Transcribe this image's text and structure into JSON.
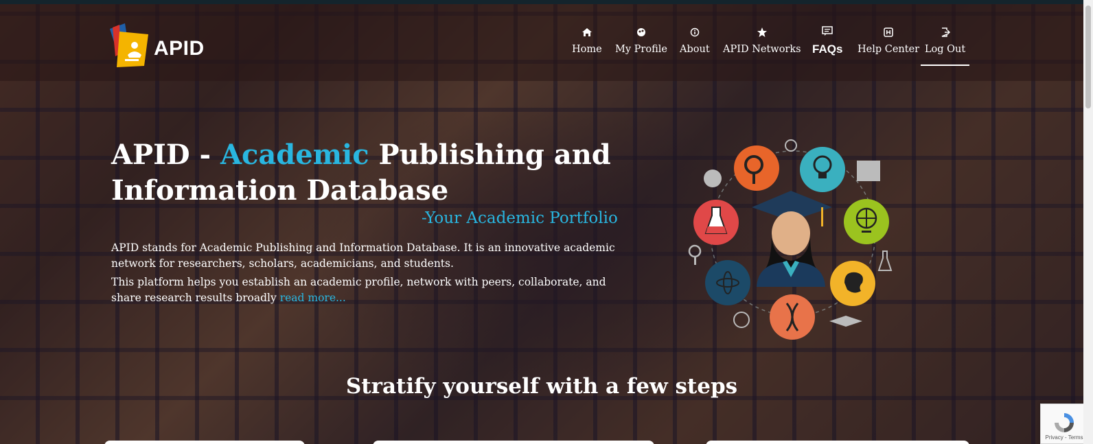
{
  "brand": {
    "logo_text": "APID",
    "accent_color": "#29b6e0"
  },
  "nav": {
    "items": [
      {
        "label": "Home",
        "icon": "home-icon"
      },
      {
        "label": "My Profile",
        "icon": "profile-icon"
      },
      {
        "label": "About",
        "icon": "info-icon"
      },
      {
        "label": "APID Networks",
        "icon": "star-icon"
      },
      {
        "label": "FAQs",
        "icon": "faq-icon"
      },
      {
        "label": "Help Center",
        "icon": "help-icon"
      },
      {
        "label": "Log Out",
        "icon": "logout-icon",
        "active": true
      }
    ]
  },
  "hero": {
    "title_part1": "APID - ",
    "title_accent": "Academic",
    "title_part2": " Publishing and Information Database",
    "tagline": "-Your Academic Portfolio",
    "desc1": "APID stands for Academic Publishing and Information Database. It is an innovative academic network for researchers, scholars, academicians, and students.",
    "desc2": "This platform helps you establish an academic profile, network with peers, collaborate, and share research results broadly",
    "read_more": "read more..."
  },
  "steps": {
    "heading": "Stratify yourself with a few steps"
  },
  "recaptcha": {
    "text": "Privacy - Terms"
  }
}
